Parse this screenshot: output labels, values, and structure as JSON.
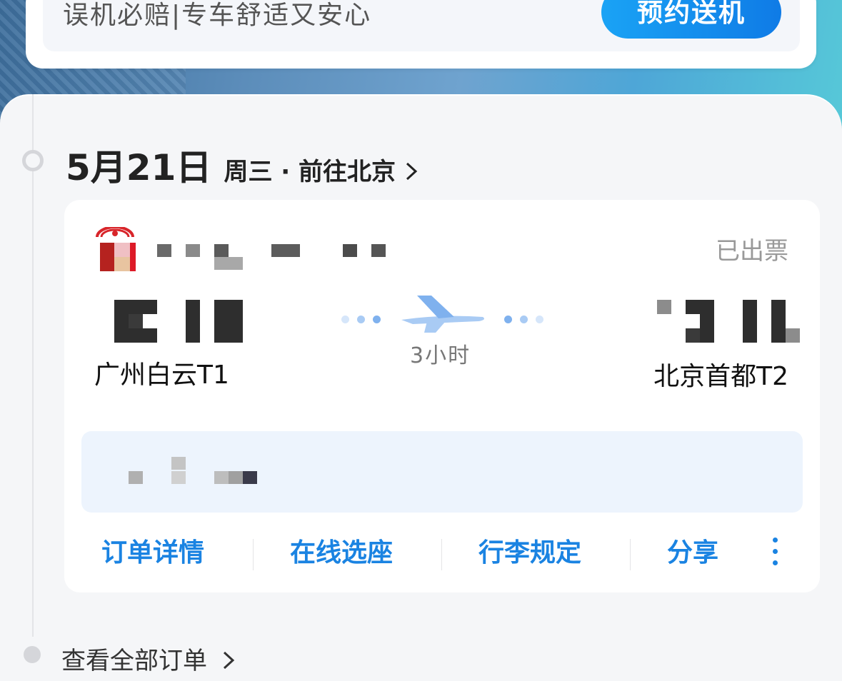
{
  "promo": {
    "text": "误机必赔|专车舒适又安心",
    "button_label": "预约送机"
  },
  "trip": {
    "date": "5月21日",
    "subtitle": "周三 · 前往北京",
    "status": "已出票",
    "duration": "3小时",
    "departure_airport": "广州白云T1",
    "arrival_airport": "北京首都T2"
  },
  "actions": {
    "order_details": "订单详情",
    "seat_selection": "在线选座",
    "baggage_rules": "行李规定",
    "share": "分享"
  },
  "footer": {
    "view_all_orders": "查看全部订单"
  },
  "icons": {
    "plane": "plane-icon",
    "chevron": "chevron-right-icon",
    "more": "more-vertical-icon",
    "airline_logo": "airline-logo"
  },
  "colors": {
    "accent": "#1a83e2",
    "status_gray": "#999999",
    "info_bg": "#edf4fd"
  }
}
